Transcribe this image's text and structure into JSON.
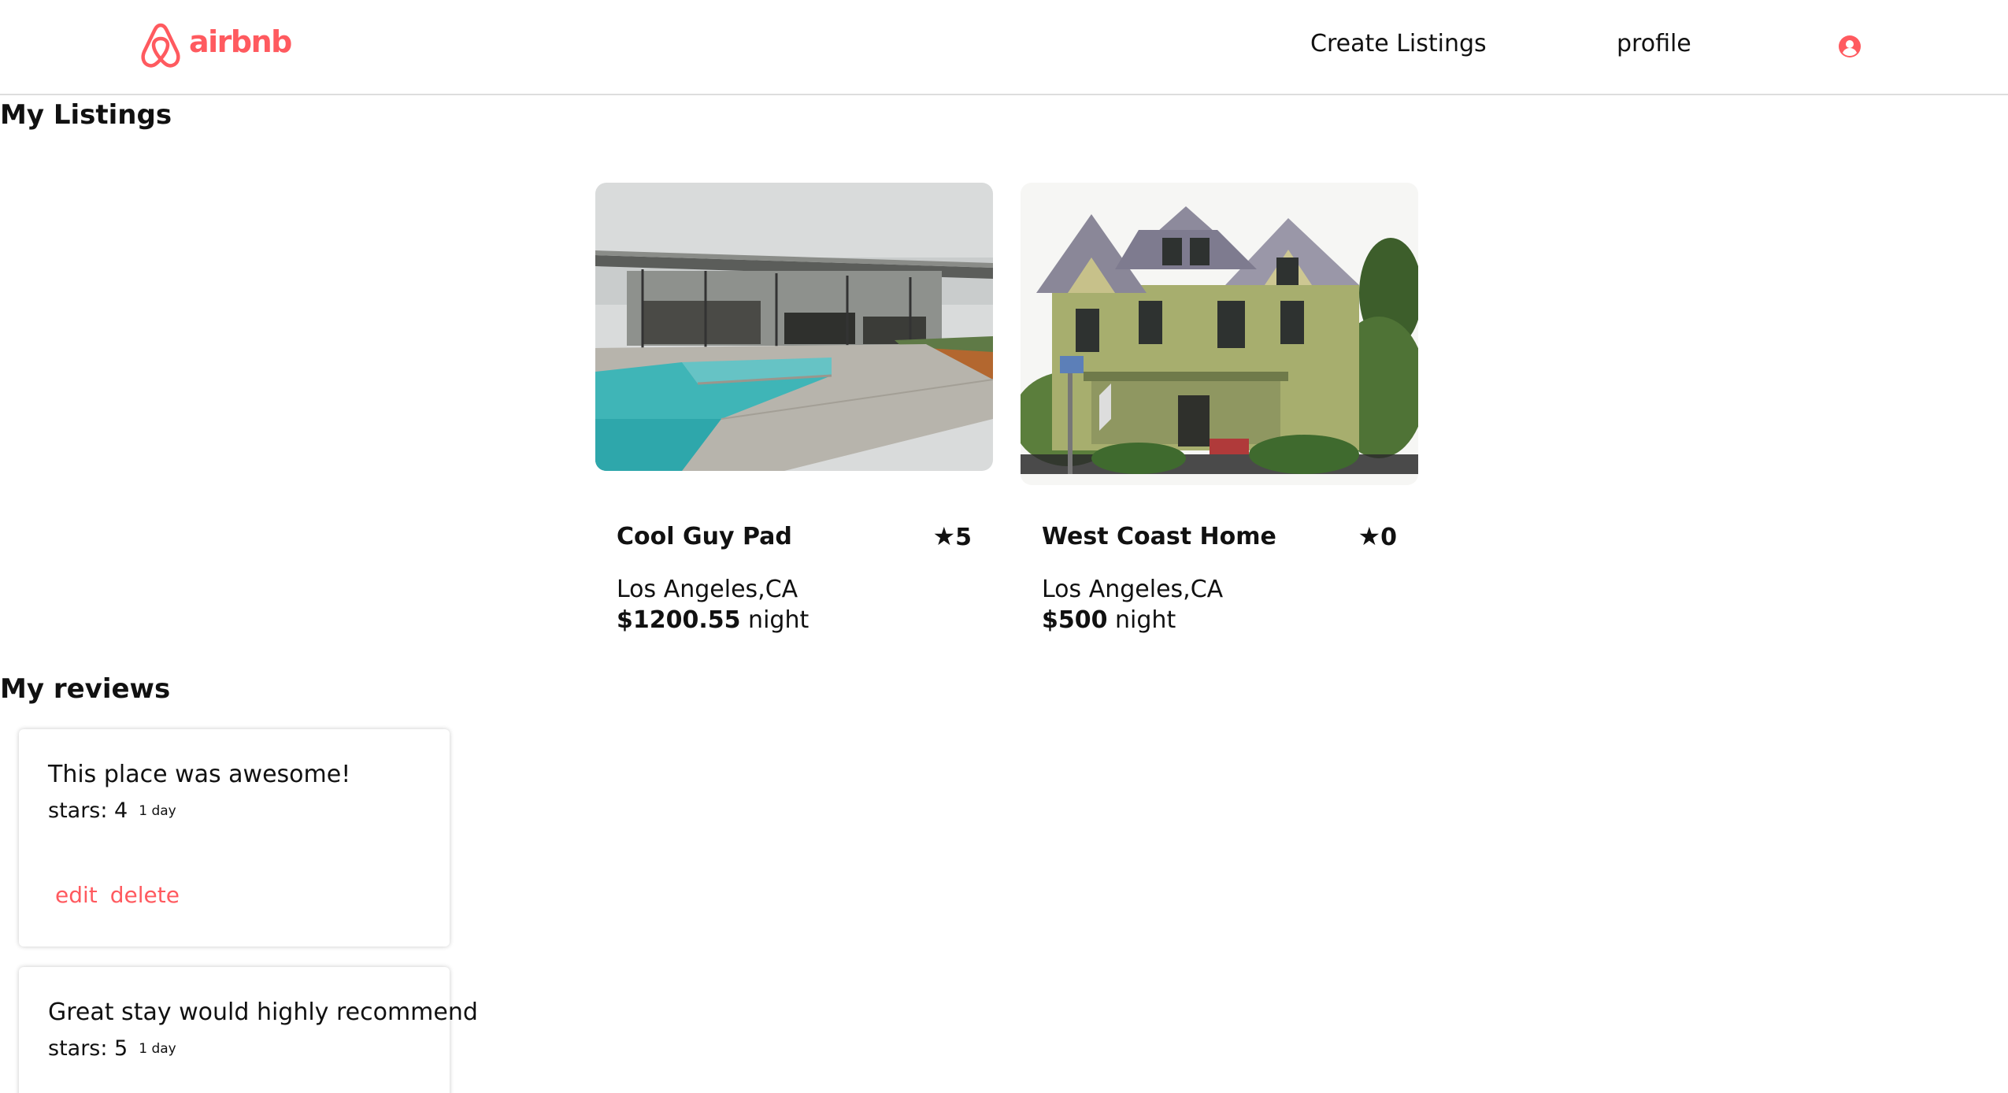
{
  "header": {
    "logo_text": "airbnb",
    "logo_icon": "airbnb-logo-icon",
    "nav": {
      "create_listings": "Create Listings",
      "profile": "profile"
    },
    "user_icon": "user-circle-icon"
  },
  "colors": {
    "brand": "#ff5a5f",
    "text": "#111111",
    "divider": "#dddddd"
  },
  "my_listings": {
    "title": "My Listings",
    "items": [
      {
        "name": "Cool Guy Pad",
        "star": "★",
        "rating": "5",
        "location": "Los Angeles,CA",
        "price": "$1200.55",
        "price_unit": " night",
        "image": "modern glass house with pool"
      },
      {
        "name": "West Coast Home",
        "star": "★",
        "rating": "0",
        "location": "Los Angeles,CA",
        "price": "$500",
        "price_unit": " night",
        "image": "victorian house"
      }
    ]
  },
  "my_reviews": {
    "title": "My reviews",
    "items": [
      {
        "text": "This place was awesome!",
        "stars_label": "stars: ",
        "stars": "4",
        "time": "1 day",
        "edit_label": "edit",
        "delete_label": "delete"
      },
      {
        "text": "Great stay would highly recommend",
        "stars_label": "stars: ",
        "stars": "5",
        "time": "1 day"
      }
    ]
  }
}
